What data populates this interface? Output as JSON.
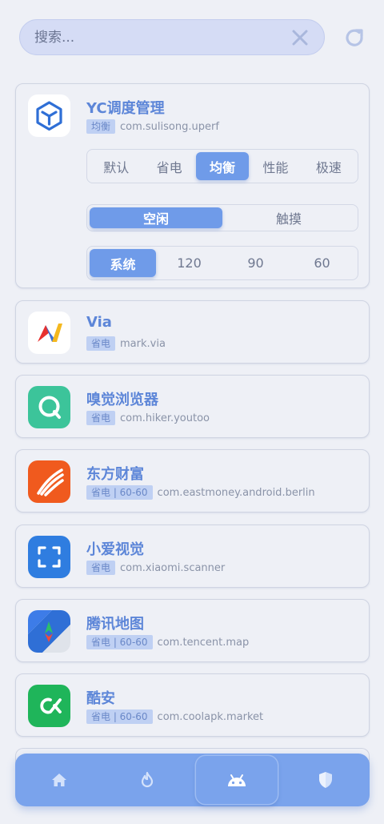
{
  "search": {
    "placeholder": "搜索..."
  },
  "apps": [
    {
      "name": "YC调度管理",
      "badge": "均衡",
      "package": "com.sulisong.uperf",
      "modes": [
        "默认",
        "省电",
        "均衡",
        "性能",
        "极速"
      ],
      "active_mode": "均衡",
      "states": [
        "空闲",
        "触摸"
      ],
      "active_state": "空闲",
      "refresh_rates": [
        "系统",
        "120",
        "90",
        "60"
      ],
      "active_rate": "系统",
      "icon": "cube-icon",
      "icon_color": "#2f6fd6"
    },
    {
      "name": "Via",
      "badge": "省电",
      "package": "mark.via",
      "icon": "via-logo-icon"
    },
    {
      "name": "嗅觉浏览器",
      "badge": "省电",
      "package": "com.hiker.youtoo",
      "icon": "chat-bubble-icon",
      "icon_color": "#3cc49a"
    },
    {
      "name": "东方财富",
      "badge": "省电 | 60-60",
      "package": "com.eastmoney.android.berlin",
      "icon": "eastmoney-logo-icon",
      "icon_color": "#f05a1e"
    },
    {
      "name": "小爱视觉",
      "badge": "省电",
      "package": "com.xiaomi.scanner",
      "icon": "scan-frame-icon",
      "icon_color": "#2f7de0"
    },
    {
      "name": "腾讯地图",
      "badge": "省电 | 60-60",
      "package": "com.tencent.map",
      "icon": "map-compass-icon"
    },
    {
      "name": "酷安",
      "badge": "省电 | 60-60",
      "package": "com.coolapk.market",
      "icon": "coolapk-logo-icon",
      "icon_color": "#1fb55a"
    }
  ],
  "nav": {
    "items": [
      "home-icon",
      "flame-icon",
      "android-icon",
      "shield-icon"
    ],
    "active": "android-icon"
  },
  "colors": {
    "accent": "#6f9be9",
    "nav_bg": "#7aa3ec",
    "title": "#5d86d8"
  }
}
